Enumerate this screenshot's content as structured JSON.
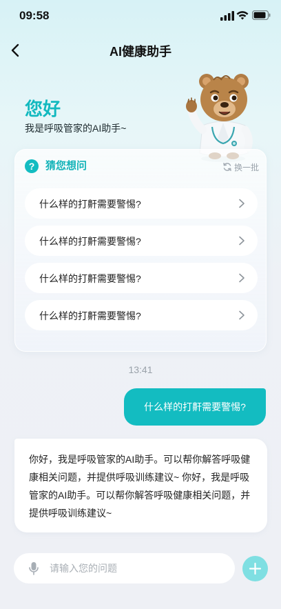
{
  "status_bar": {
    "time": "09:58"
  },
  "nav": {
    "title": "AI健康助手",
    "back_icon": "chevron-left-icon"
  },
  "greeting": {
    "title": "您好",
    "subtitle": "我是呼吸管家的AI助手~"
  },
  "suggestions": {
    "title": "猜您想问",
    "refresh_label": "换一批",
    "items": [
      {
        "label": "什么样的打鼾需要警惕?"
      },
      {
        "label": "什么样的打鼾需要警惕?"
      },
      {
        "label": "什么样的打鼾需要警惕?"
      },
      {
        "label": "什么样的打鼾需要警惕?"
      }
    ]
  },
  "chat": {
    "timestamp": "13:41",
    "user_message": "什么样的打鼾需要警惕?",
    "ai_message": "你好，我是呼吸管家的AI助手。可以帮你解答呼吸健康相关问题，并提供呼吸训练建议~ 你好，我是呼吸管家的AI助手。可以帮你解答呼吸健康相关问题，并提供呼吸训练建议~"
  },
  "composer": {
    "placeholder": "请输入您的问题",
    "value": ""
  },
  "colors": {
    "accent": "#13bcc1",
    "add_button": "#7fdfe2"
  }
}
